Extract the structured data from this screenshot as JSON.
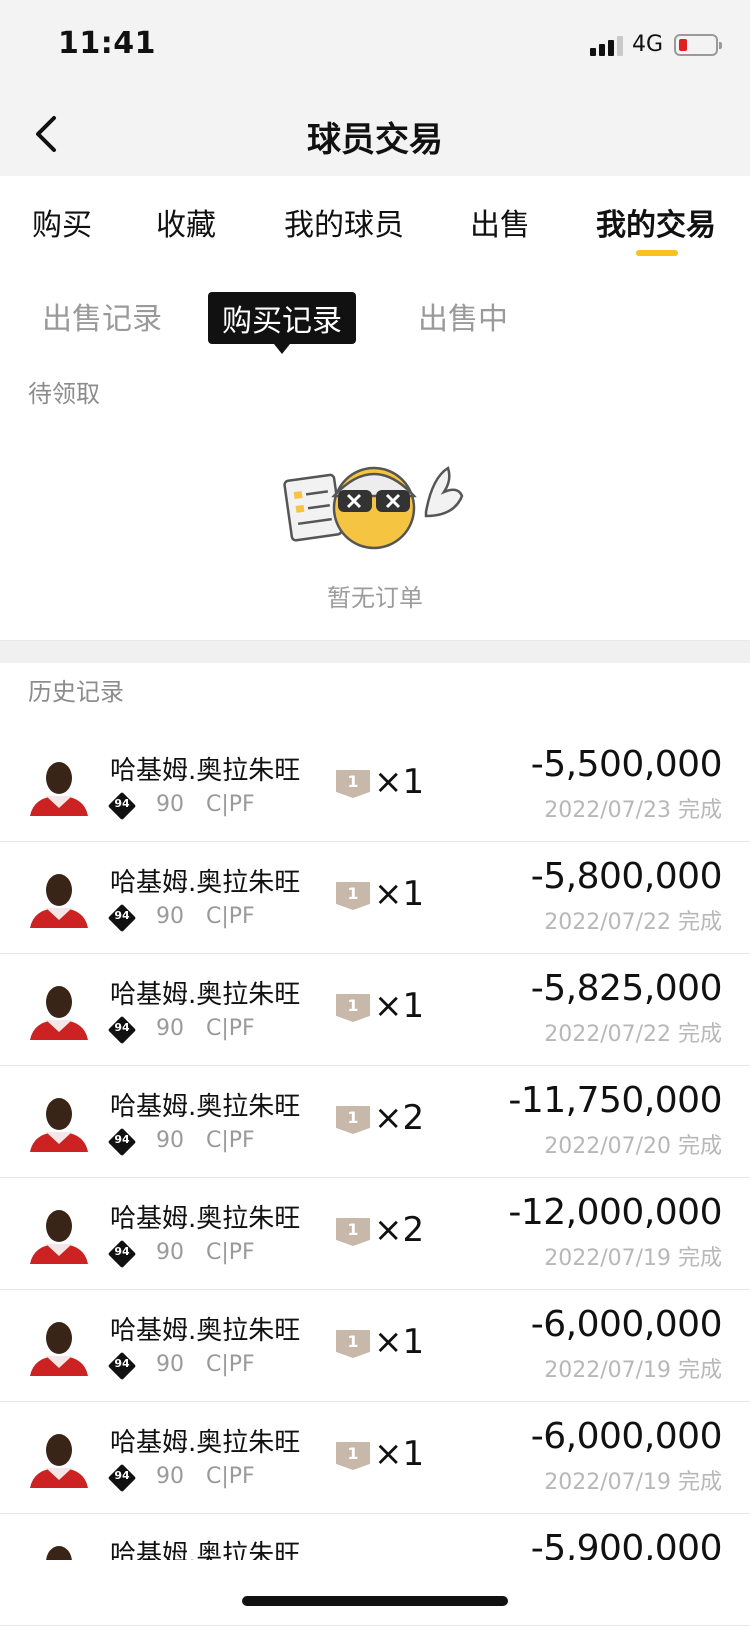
{
  "status": {
    "time": "11:41",
    "network": "4G"
  },
  "nav": {
    "title": "球员交易"
  },
  "tabs": [
    {
      "label": "购买"
    },
    {
      "label": "收藏"
    },
    {
      "label": "我的球员"
    },
    {
      "label": "出售"
    },
    {
      "label": "我的交易"
    }
  ],
  "active_tab": "我的交易",
  "subtabs": [
    {
      "label": "出售记录"
    },
    {
      "label": "购买记录"
    },
    {
      "label": "出售中"
    }
  ],
  "active_subtab": "购买记录",
  "pending": {
    "label": "待领取",
    "empty_text": "暂无订单"
  },
  "history": {
    "label": "历史记录",
    "rows": [
      {
        "name": "哈基姆.奥拉朱旺",
        "ovr": "94",
        "rating": "90",
        "position": "C|PF",
        "card_level": "1",
        "qty": "×1",
        "price": "-5,500,000",
        "date": "2022/07/23 完成"
      },
      {
        "name": "哈基姆.奥拉朱旺",
        "ovr": "94",
        "rating": "90",
        "position": "C|PF",
        "card_level": "1",
        "qty": "×1",
        "price": "-5,800,000",
        "date": "2022/07/22 完成"
      },
      {
        "name": "哈基姆.奥拉朱旺",
        "ovr": "94",
        "rating": "90",
        "position": "C|PF",
        "card_level": "1",
        "qty": "×1",
        "price": "-5,825,000",
        "date": "2022/07/22 完成"
      },
      {
        "name": "哈基姆.奥拉朱旺",
        "ovr": "94",
        "rating": "90",
        "position": "C|PF",
        "card_level": "1",
        "qty": "×2",
        "price": "-11,750,000",
        "date": "2022/07/20 完成"
      },
      {
        "name": "哈基姆.奥拉朱旺",
        "ovr": "94",
        "rating": "90",
        "position": "C|PF",
        "card_level": "1",
        "qty": "×2",
        "price": "-12,000,000",
        "date": "2022/07/19 完成"
      },
      {
        "name": "哈基姆.奥拉朱旺",
        "ovr": "94",
        "rating": "90",
        "position": "C|PF",
        "card_level": "1",
        "qty": "×1",
        "price": "-6,000,000",
        "date": "2022/07/19 完成"
      },
      {
        "name": "哈基姆.奥拉朱旺",
        "ovr": "94",
        "rating": "90",
        "position": "C|PF",
        "card_level": "1",
        "qty": "×1",
        "price": "-6,000,000",
        "date": "2022/07/19 完成"
      },
      {
        "name": "哈基姆.奥拉朱旺",
        "ovr": "",
        "rating": "",
        "position": "",
        "card_level": "",
        "qty": "",
        "price": "-5,900,000",
        "date": ""
      }
    ]
  },
  "colors": {
    "accent": "#f7c21b",
    "card": "#c7b8a9",
    "muted": "#9a9a9a"
  }
}
